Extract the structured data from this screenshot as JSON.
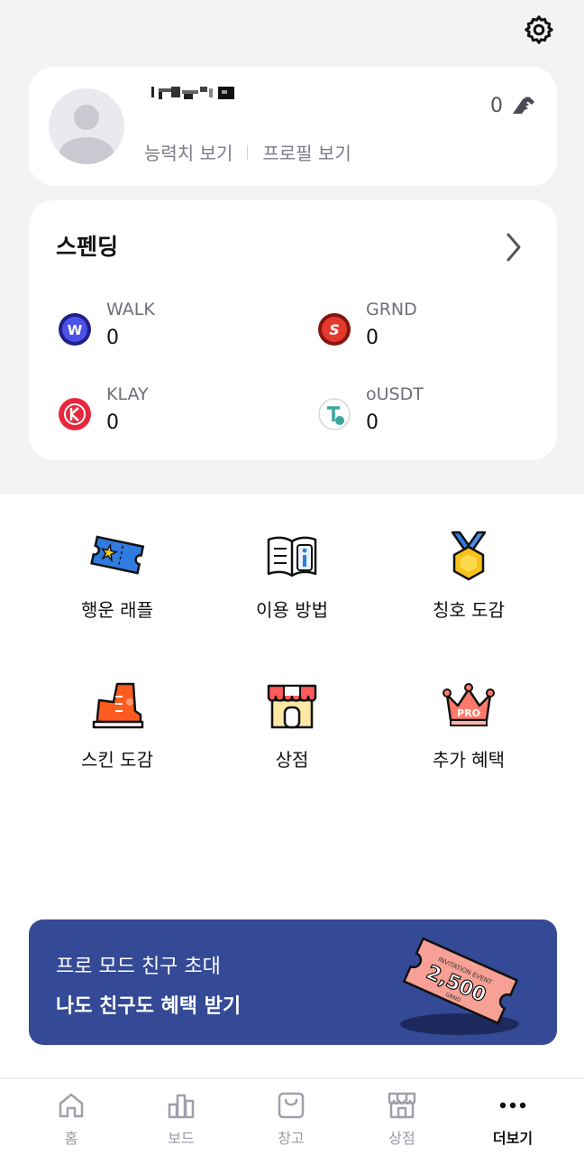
{
  "profile": {
    "stats_link": "능력치 보기",
    "profile_link": "프로필 보기",
    "shoe_count": "0"
  },
  "spending": {
    "title": "스펜딩",
    "tokens": [
      {
        "name": "WALK",
        "value": "0",
        "color": "#3b3fd6"
      },
      {
        "name": "GRND",
        "value": "0",
        "color": "#e23b2e"
      },
      {
        "name": "KLAY",
        "value": "0",
        "color": "#e8273d"
      },
      {
        "name": "oUSDT",
        "value": "0",
        "color": "#3aa89a"
      }
    ]
  },
  "menu": [
    {
      "label": "행운 래플",
      "icon": "ticket-icon"
    },
    {
      "label": "이용 방법",
      "icon": "book-icon"
    },
    {
      "label": "칭호 도감",
      "icon": "medal-icon"
    },
    {
      "label": "스킨 도감",
      "icon": "sneaker-icon"
    },
    {
      "label": "상점",
      "icon": "store-icon"
    },
    {
      "label": "추가 혜택",
      "icon": "pro-crown-icon"
    }
  ],
  "banner": {
    "line1": "프로 모드 친구 초대",
    "line2": "나도 친구도 혜택 받기",
    "ticket_top": "INVITATION EVENT",
    "ticket_amount": "2,500",
    "ticket_unit": "GRND"
  },
  "nav": [
    {
      "label": "홈",
      "icon": "home-icon"
    },
    {
      "label": "보드",
      "icon": "chart-icon"
    },
    {
      "label": "창고",
      "icon": "bag-icon"
    },
    {
      "label": "상점",
      "icon": "shop-icon"
    },
    {
      "label": "더보기",
      "icon": "more-icon"
    }
  ],
  "icons": {
    "pro_badge": "PRO"
  }
}
